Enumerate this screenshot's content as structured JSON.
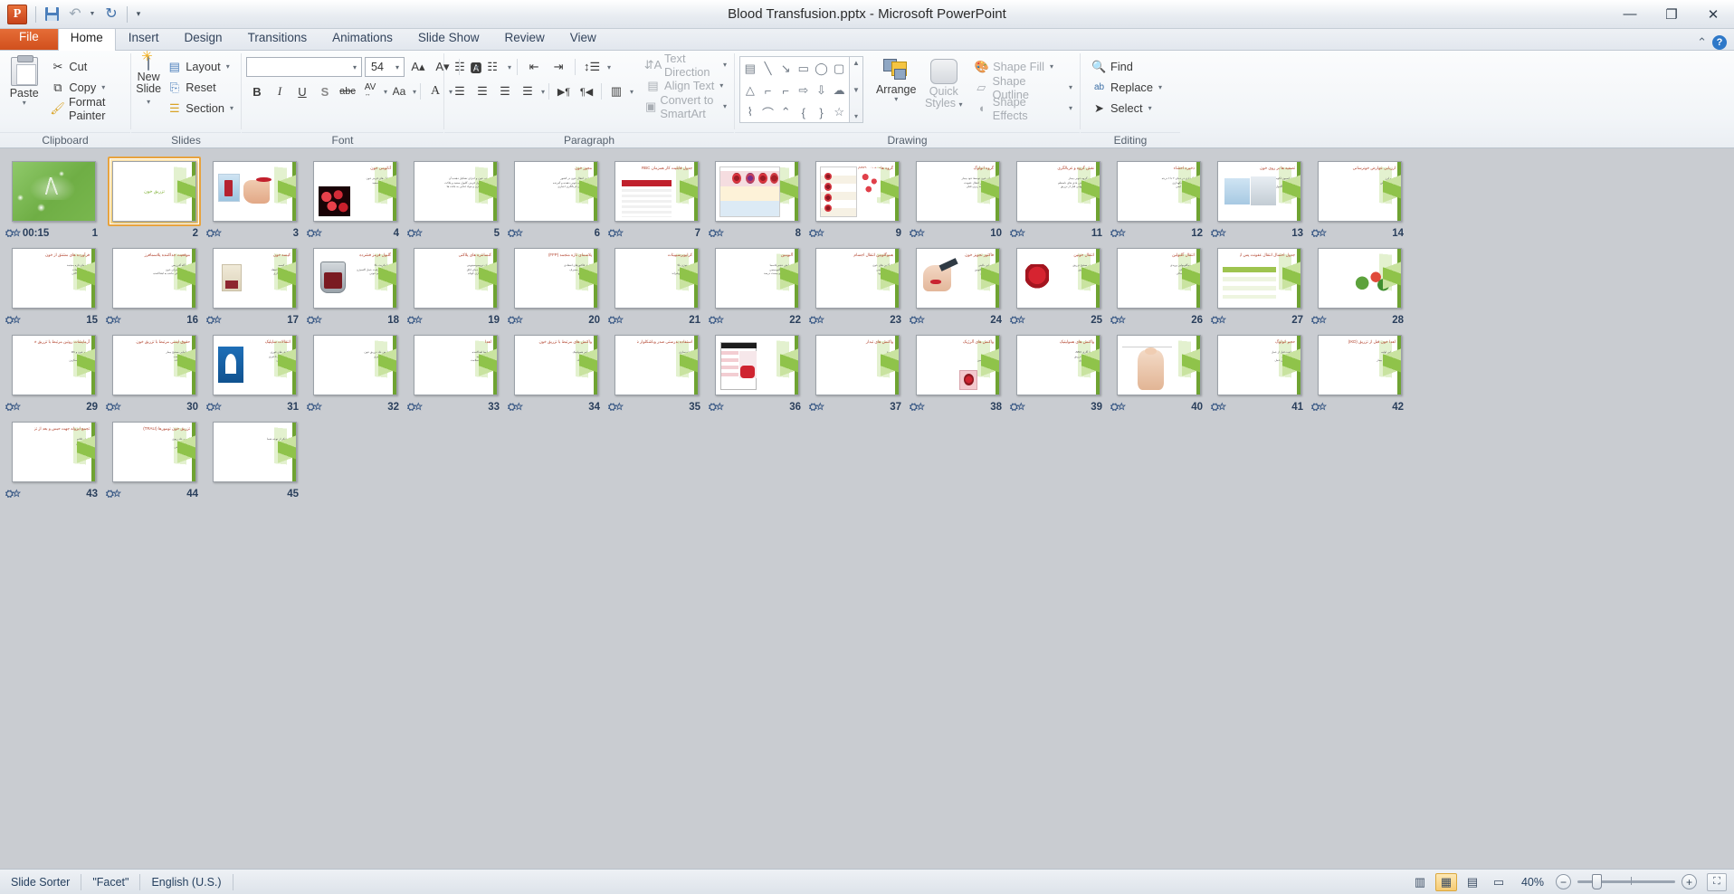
{
  "window": {
    "title": "Blood Transfusion.pptx  -  Microsoft PowerPoint",
    "app_logo": "P",
    "minimize": "—",
    "restore": "❐",
    "close": "✕"
  },
  "quick_access": {
    "save_tip": "Save",
    "undo_tip": "Undo",
    "redo_tip": "Redo",
    "customize_tip": "Customize Quick Access Toolbar"
  },
  "tabs": [
    {
      "label": "File",
      "active": false,
      "file": true
    },
    {
      "label": "Home",
      "active": true,
      "file": false
    },
    {
      "label": "Insert",
      "active": false,
      "file": false
    },
    {
      "label": "Design",
      "active": false,
      "file": false
    },
    {
      "label": "Transitions",
      "active": false,
      "file": false
    },
    {
      "label": "Animations",
      "active": false,
      "file": false
    },
    {
      "label": "Slide Show",
      "active": false,
      "file": false
    },
    {
      "label": "Review",
      "active": false,
      "file": false
    },
    {
      "label": "View",
      "active": false,
      "file": false
    }
  ],
  "ribbon": {
    "clipboard": {
      "label": "Clipboard",
      "paste": "Paste",
      "cut": "Cut",
      "copy": "Copy",
      "format_painter": "Format Painter"
    },
    "slides": {
      "label": "Slides",
      "new_slide": "New\nSlide",
      "new_slide_l1": "New",
      "new_slide_l2": "Slide",
      "layout": "Layout",
      "reset": "Reset",
      "section": "Section"
    },
    "font": {
      "label": "Font",
      "font_name": "",
      "font_name_placeholder": "",
      "font_size": "54",
      "grow_font": "A",
      "shrink_font": "A",
      "clear_formatting": "Aa",
      "bold": "B",
      "italic": "I",
      "underline": "U",
      "shadow": "S",
      "strikethrough": "abc",
      "character_spacing": "AV",
      "change_case": "Aa",
      "font_color": "A"
    },
    "paragraph": {
      "label": "Paragraph",
      "bullets": "bullets",
      "numbering": "numbering",
      "decrease_indent": "decrease-indent",
      "increase_indent": "increase-indent",
      "line_spacing": "line-spacing",
      "align_left": "align-left",
      "align_center": "align-center",
      "align_right": "align-right",
      "justify": "justify",
      "ltr": "ltr",
      "rtl": "rtl",
      "columns": "columns",
      "text_direction": "Text Direction",
      "align_text": "Align Text",
      "convert_to_smartart": "Convert to SmartArt"
    },
    "drawing": {
      "label": "Drawing",
      "arrange": "Arrange",
      "quick_styles_l1": "Quick",
      "quick_styles_l2": "Styles",
      "shape_fill": "Shape Fill",
      "shape_outline": "Shape Outline",
      "shape_effects": "Shape Effects",
      "shapes": [
        "▤",
        "╲",
        "↘",
        "▭",
        "◯",
        "▢",
        "△",
        "⌐",
        "⌐",
        "⇨",
        "⇩",
        "☁",
        "⌇",
        "⌒",
        "⌃",
        "{",
        "}",
        "☆"
      ]
    },
    "editing": {
      "label": "Editing",
      "find": "Find",
      "replace": "Replace",
      "select": "Select"
    }
  },
  "slides": [
    {
      "n": "1",
      "title": "",
      "body": "",
      "center": "",
      "theme": "title-green",
      "timing": "00:15",
      "transition": true
    },
    {
      "n": "2",
      "title": "",
      "body": "",
      "center": "تزریق خون",
      "theme": "facet",
      "timing": "",
      "transition": false
    },
    {
      "n": "3",
      "title": "",
      "body": "",
      "center": "",
      "theme": "facet-img",
      "timing": "",
      "transition": true
    },
    {
      "n": "4",
      "title": "آناتومی خون",
      "body": "سلول های قرمز خون\nگلبول های سفید\nپلاکت ها",
      "center": "",
      "theme": "facet-img2",
      "timing": "",
      "transition": true
    },
    {
      "n": "5",
      "title": "",
      "body": "تعریف خون و اجزای تشکیل دهنده آن\nپلاسما، گلبول قرمز، گلبول سفید و پلاکت\nانتقال اکسیژن و مواد غذایی به بافت ها",
      "center": "",
      "theme": "facet",
      "timing": "",
      "transition": true
    },
    {
      "n": "6",
      "title": "مجوز خون",
      "body": "قوانین انتقال خون در کشور\nانطباق گروه خونی دهنده و گیرنده\nآزمایش های غربالگری اجباری",
      "center": "",
      "theme": "facet",
      "timing": "",
      "transition": true
    },
    {
      "n": "7",
      "title": "جدول قابلیت کار همزمان RBC",
      "body": "",
      "center": "",
      "theme": "facet-table",
      "timing": "",
      "transition": true
    },
    {
      "n": "8",
      "title": "",
      "body": "",
      "center": "",
      "theme": "facet-chart",
      "timing": "",
      "transition": true
    },
    {
      "n": "9",
      "title": "گروه های خونی ABO",
      "body": "",
      "center": "",
      "theme": "facet-chart2",
      "timing": "",
      "transition": true
    },
    {
      "n": "10",
      "title": "گروه اتولوگ",
      "body": "اهدای خون توسط خود بیمار\nکاهش خطر انتقال عفونت\nنیاز به برنامه ریزی قبلی",
      "center": "",
      "theme": "facet",
      "timing": "",
      "transition": true
    },
    {
      "n": "11",
      "title": "نقش گروه و غربالگری",
      "body": "تعیین گروه خونی بیمار\nجستجوی آنتی بادی های نامنظم\nکراس مچ نهایی قبل از تزریق",
      "center": "",
      "theme": "facet",
      "timing": "",
      "transition": true
    },
    {
      "n": "12",
      "title": "ذخیره احشاء",
      "body": "نگهداری در دمای ۲ تا ۶ درجه\nمدت زمان نگهداری\nحمل و نقل ایمن",
      "center": "",
      "theme": "facet",
      "timing": "",
      "transition": true
    },
    {
      "n": "13",
      "title": "تصفیه ها بر روی خون",
      "body": "فیلتراسیون لکوسیت\nاشعه دهی\nشستشوی گلبول قرمز",
      "center": "",
      "theme": "facet-img3",
      "timing": "",
      "transition": true
    },
    {
      "n": "14",
      "title": "ارزیابی عوارض خونرسانی",
      "body": "تب و لرز\nکهیر و خارش\nتنگی نفس",
      "center": "",
      "theme": "facet",
      "timing": "",
      "transition": true
    },
    {
      "n": "15",
      "title": "فرآورده های مشتق از خون",
      "body": "پلاسمای تازه منجمد\nکرایوپرسیپیتات\nکنسانتره پلاکتی",
      "center": "",
      "theme": "facet",
      "timing": "",
      "transition": true
    },
    {
      "n": "16",
      "title": "موقعیت جداکننده پلاسمافرز",
      "body": "دستگاه آفرزیس\nجداسازی اجزای خون\nبازگشت باقی مانده به اهداکننده",
      "center": "",
      "theme": "facet",
      "timing": "",
      "transition": true
    },
    {
      "n": "17",
      "title": "کیسه خون",
      "body": "حجم کیسه\nمحلول ضد انعقاد\nبرچسب گذاری",
      "center": "",
      "theme": "facet-img4",
      "timing": "",
      "transition": true
    },
    {
      "n": "18",
      "title": "گلبول قرمز فشرده",
      "body": "هماتوکریت بالا\nافزایش ظرفیت حمل اکسیژن\nکاربرد در کم خونی",
      "center": "",
      "theme": "facet-img5",
      "timing": "",
      "transition": true
    },
    {
      "n": "19",
      "title": "کنسانتره های پلاکتی",
      "body": "درمان ترومبوسیتوپنی\nنگهداری در دمای اتاق\nمدت ماندگاری کوتاه",
      "center": "",
      "theme": "facet",
      "timing": "",
      "transition": true
    },
    {
      "n": "20",
      "title": "پلاسمای تازه منجمد (FFP)",
      "body": "حاوی فاکتورهای انعقادی\nذوب قبل از مصرف\nتزریق سریع",
      "center": "",
      "theme": "facet",
      "timing": "",
      "transition": true
    },
    {
      "n": "21",
      "title": "کرایوپرسیپیتات",
      "body": "فیبرینوژن بالا\nفاکتور هشت\nفاکتور ون ویلبراند",
      "center": "",
      "theme": "facet",
      "timing": "",
      "transition": true
    },
    {
      "n": "22",
      "title": "آلبومین",
      "body": "افزایش حجم پلاسما\nدرمان هیپوآلبومینمی\nمحلول پنج و بیست درصد",
      "center": "",
      "theme": "facet",
      "timing": "",
      "transition": true
    },
    {
      "n": "23",
      "title": "هموگلوبین انتقال اجسام",
      "body": "جایگزین های خون\nتحقیقات بالینی\nکاربرد محدود",
      "center": "",
      "theme": "facet",
      "timing": "",
      "transition": true
    },
    {
      "n": "24",
      "title": "فاکتور تجویز خون",
      "body": "ارزیابی بالینی\nسطح هموگلوبین\nعلائم حیاتی",
      "center": "",
      "theme": "facet-img6",
      "timing": "",
      "transition": true
    },
    {
      "n": "25",
      "title": "انتقال خونین",
      "body": "روش صحیح تزریق\nسرعت تزریق\nپایش بیمار",
      "center": "",
      "theme": "facet-img7",
      "timing": "",
      "transition": true
    },
    {
      "n": "26",
      "title": "انتقال گلبولین",
      "body": "ایمونوگلوبولین وریدی\nموارد مصرف\nعوارض احتمالی",
      "center": "",
      "theme": "facet",
      "timing": "",
      "transition": true
    },
    {
      "n": "27",
      "title": "جدول احتمال انتقال عفونت پس از تزریق خون",
      "body": "",
      "center": "",
      "theme": "facet-table2",
      "timing": "",
      "transition": true
    },
    {
      "n": "28",
      "title": "",
      "body": "",
      "center": "",
      "theme": "facet-img8",
      "timing": "",
      "transition": true
    },
    {
      "n": "29",
      "title": "آزمایشات روتین مرتبط با تزریق خون",
      "body": "گروه خون و Rh\nکراس مچ\nآنتی بادی اسکرین",
      "center": "",
      "theme": "facet",
      "timing": "",
      "transition": true
    },
    {
      "n": "30",
      "title": "حقوق ایمنی مرتبط با تزریق خون",
      "body": "شناسایی صحیح بیمار\nکنترل برچسب\nثبت مستندات",
      "center": "",
      "theme": "facet",
      "timing": "",
      "transition": true
    },
    {
      "n": "31",
      "title": "انتقالات ساپلیک",
      "body": "واکنش های فوری\nواکنش های تاخیری\nگزارش دهی",
      "center": "",
      "theme": "facet-img9",
      "timing": "",
      "transition": true
    },
    {
      "n": "32",
      "title": "",
      "body": "عوارض حاد تزریق خون\nعوارض تاخیری\nپیشگیری",
      "center": "",
      "theme": "facet",
      "timing": "",
      "transition": true
    },
    {
      "n": "33",
      "title": "اهدا",
      "body": "شرایط اهداکننده\nمعاینات اولیه\nپرسشنامه سلامت",
      "center": "",
      "theme": "facet",
      "timing": "",
      "transition": true
    },
    {
      "n": "34",
      "title": "واکنش های مرتبط با تزریق خون",
      "body": "تب غیر همولیتیک\nآلرژیک\nهمولیتیک حاد",
      "center": "",
      "theme": "facet",
      "timing": "",
      "transition": true
    },
    {
      "n": "35",
      "title": "استفاده بدرستی صدر وباشکلوار شده",
      "body": "آماده سازی\nتزریق\nپایش",
      "center": "",
      "theme": "facet",
      "timing": "",
      "transition": true
    },
    {
      "n": "36",
      "title": "",
      "body": "",
      "center": "",
      "theme": "facet-img10",
      "timing": "",
      "transition": true
    },
    {
      "n": "37",
      "title": "واکنش های تبدار",
      "body": "شیوع\nعلائم\nدرمان",
      "center": "",
      "theme": "facet",
      "timing": "",
      "transition": true
    },
    {
      "n": "38",
      "title": "واکنش های آلرژیک",
      "body": "کهیر\nخارش\nآنتی هیستامین",
      "center": "",
      "theme": "facet-img11",
      "timing": "",
      "transition": true
    },
    {
      "n": "39",
      "title": "واکنش های همولیتیک",
      "body": "ناسازگاری ABO\nقطع فوری تزریق\nحمایت کلیوی",
      "center": "",
      "theme": "facet",
      "timing": "",
      "transition": true
    },
    {
      "n": "40",
      "title": "",
      "body": "",
      "center": "",
      "theme": "facet-img12",
      "timing": "",
      "transition": true
    },
    {
      "n": "41",
      "title": "حجم اتولوگ",
      "body": "برداشت قبل از عمل\nرقیق سازی\nبازیافت حین عمل",
      "center": "",
      "theme": "facet",
      "timing": "",
      "transition": true
    },
    {
      "n": "42",
      "title": "اهدا خون قبل از تزریق (IKD)",
      "body": "ارزیابی اولیه\nنگهداری\nبازگشت به بیمار",
      "center": "",
      "theme": "facet",
      "timing": "",
      "transition": true
    },
    {
      "n": "43",
      "title": "تجمع ایزوله جهت حبس و بعد از تزریق عباسی",
      "body": "پایش علائم\nثبت گزارش\nپیگیری",
      "center": "",
      "theme": "facet",
      "timing": "",
      "transition": true
    },
    {
      "n": "44",
      "title": "تزریق خون تومورها (TRALI)",
      "body": "آسیب حاد ریوی\nتشخیص\nدرمان حمایتی",
      "center": "",
      "theme": "facet",
      "timing": "",
      "transition": true
    },
    {
      "n": "45",
      "title": "",
      "body": "با تشکر از توجه شما",
      "center": "",
      "theme": "facet",
      "timing": "",
      "transition": false
    }
  ],
  "status": {
    "view_name": "Slide Sorter",
    "theme_name": "\"Facet\"",
    "language": "English (U.S.)",
    "zoom": "40%",
    "views": [
      {
        "name": "normal-view",
        "glyph": "▥",
        "active": false
      },
      {
        "name": "slide-sorter-view",
        "glyph": "▦",
        "active": true
      },
      {
        "name": "reading-view",
        "glyph": "▤",
        "active": false
      },
      {
        "name": "slide-show-view",
        "glyph": "▭",
        "active": false
      }
    ],
    "zoom_out": "−",
    "zoom_in": "+",
    "fit_to_window": "⛶"
  }
}
